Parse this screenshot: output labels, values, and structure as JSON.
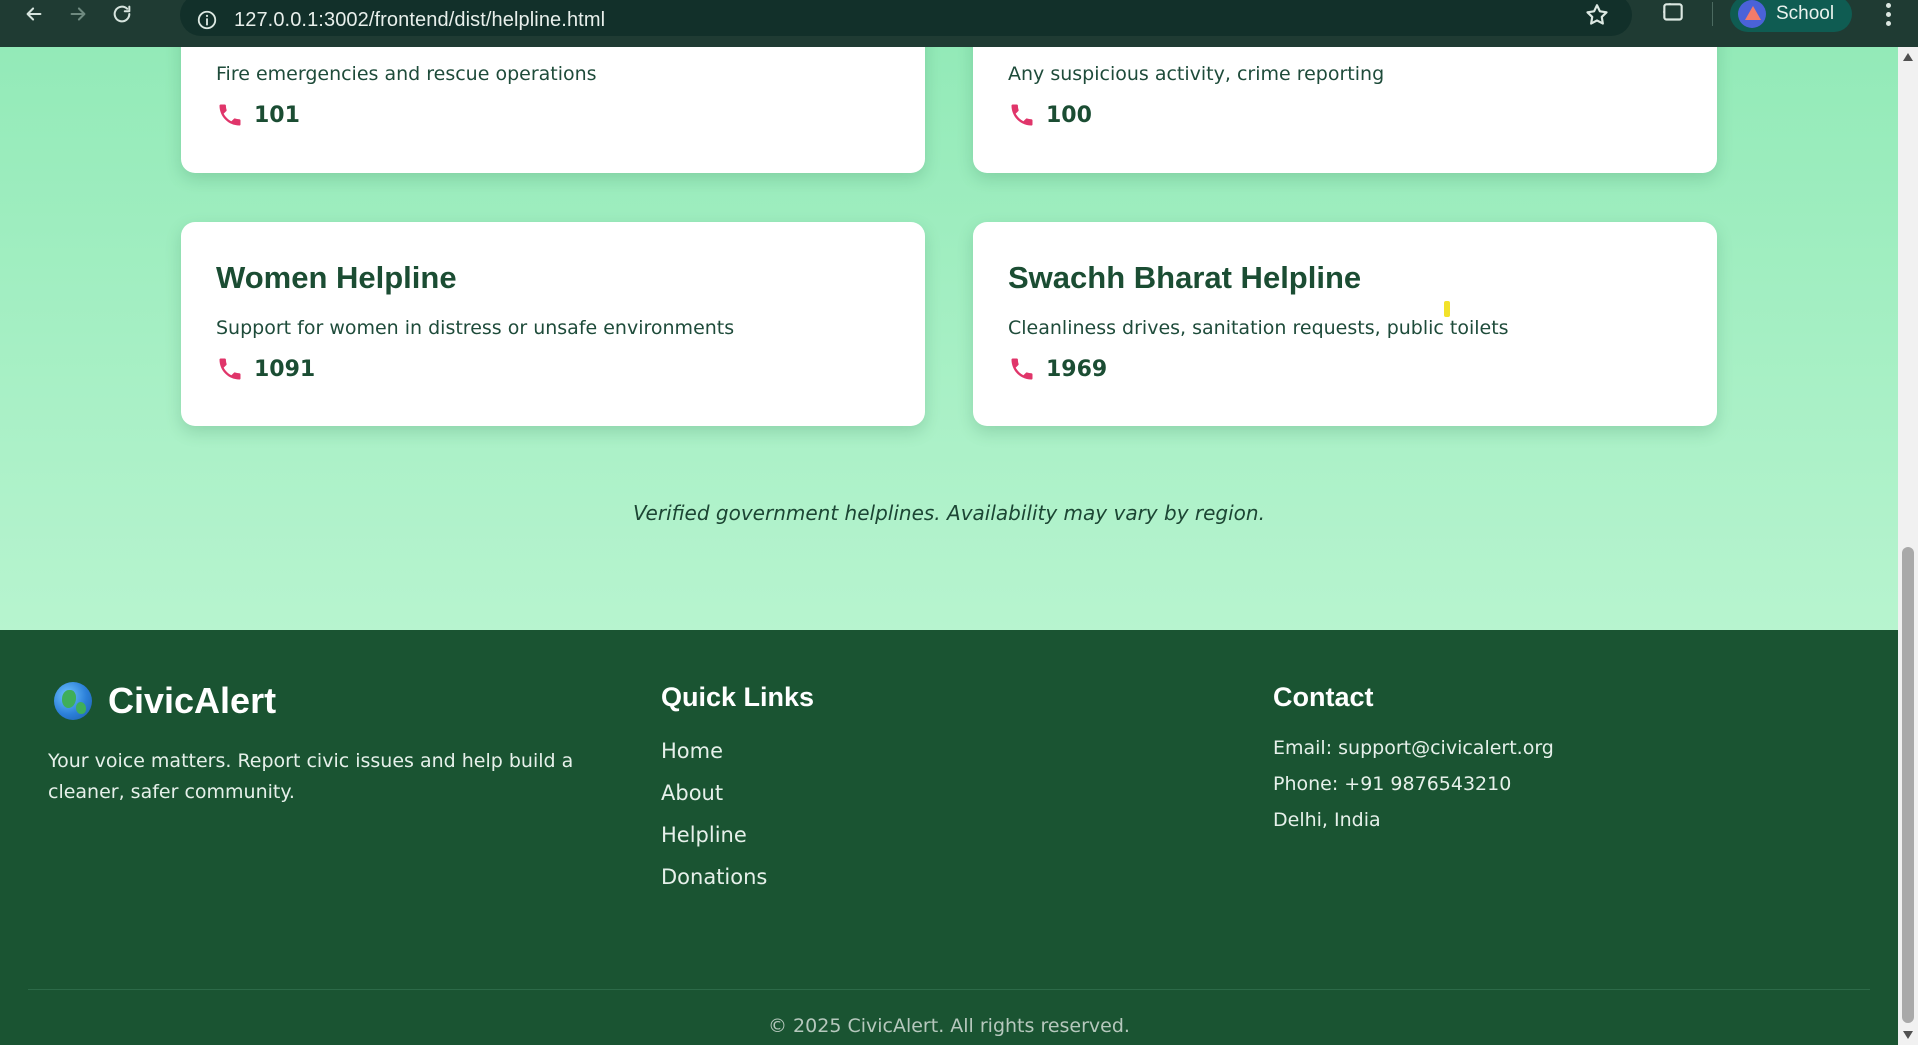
{
  "browser": {
    "url": "127.0.0.1:3002/frontend/dist/helpline.html",
    "profile_label": "School"
  },
  "helplines": [
    {
      "description": "Fire emergencies and rescue operations",
      "number": "101"
    },
    {
      "description": "Any suspicious activity, crime reporting",
      "number": "100"
    },
    {
      "title": "Women Helpline",
      "description": "Support for women in distress or unsafe environments",
      "number": "1091"
    },
    {
      "title": "Swachh Bharat Helpline",
      "description": "Cleanliness drives, sanitation requests, public toilets",
      "number": "1969"
    }
  ],
  "note": "Verified government helplines. Availability may vary by region.",
  "footer": {
    "brand": "CivicAlert",
    "tagline": "Your voice matters. Report civic issues and help build a cleaner, safer community.",
    "quick_links_title": "Quick Links",
    "quick_links": [
      "Home",
      "About",
      "Helpline",
      "Donations"
    ],
    "contact_title": "Contact",
    "contact": [
      "Email: support@civicalert.org",
      "Phone: +91 9876543210",
      "Delhi, India"
    ],
    "copyright": "© 2025 CivicAlert. All rights reserved."
  },
  "colors": {
    "page_gradient_top": "#93eab8",
    "page_gradient_bottom": "#b7f4cf",
    "footer_bg": "#1a5432",
    "card_title": "#1b4d33",
    "phone_icon": "#e0356a"
  },
  "icons": {
    "phone": "phone-icon",
    "globe": "globe-icon"
  }
}
